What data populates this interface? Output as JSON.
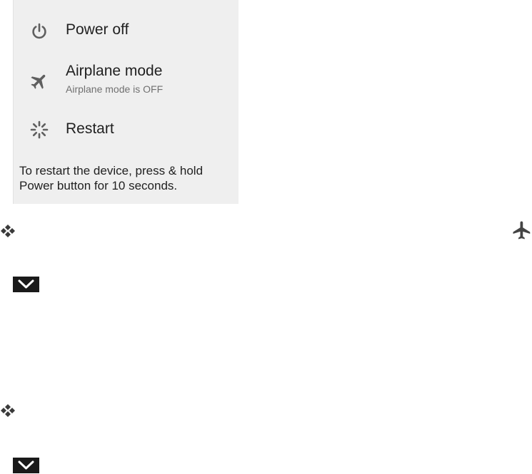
{
  "power_menu": {
    "items": [
      {
        "icon": "power-icon",
        "label": "Power off"
      },
      {
        "icon": "airplane-icon",
        "label": "Airplane mode",
        "sublabel": "Airplane mode is OFF"
      },
      {
        "icon": "restart-icon",
        "label": "Restart"
      }
    ],
    "restart_note": "To restart the device, press & hold Power button for 10 seconds."
  },
  "page_icons": {
    "bullet": "diamond-bullet-icon",
    "dropdown": "chevron-down-icon",
    "side_icon": "airplane-icon"
  },
  "colors": {
    "panel_background": "#efefef",
    "icon_gray": "#5f5f5f",
    "chevron_box": "#1a1a1a"
  }
}
